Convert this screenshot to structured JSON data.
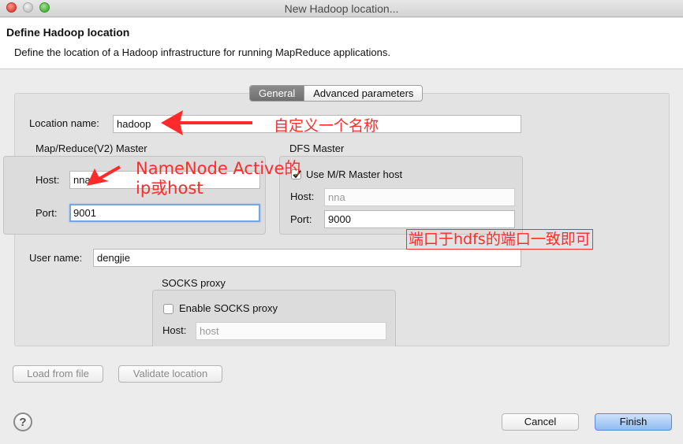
{
  "window": {
    "title": "New Hadoop location..."
  },
  "header": {
    "title": "Define Hadoop location",
    "description": "Define the location of a Hadoop infrastructure for running MapReduce applications."
  },
  "tabs": [
    {
      "label": "General",
      "selected": true
    },
    {
      "label": "Advanced parameters",
      "selected": false
    }
  ],
  "form": {
    "location_name": {
      "label": "Location name:",
      "value": "hadoop"
    },
    "mapreduce_master": {
      "title": "Map/Reduce(V2) Master",
      "host_label": "Host:",
      "host_value": "nna",
      "port_label": "Port:",
      "port_value": "9001"
    },
    "dfs_master": {
      "title": "DFS Master",
      "use_mr_host_label": "Use M/R Master host",
      "use_mr_host_checked": true,
      "host_label": "Host:",
      "host_placeholder": "nna",
      "port_label": "Port:",
      "port_value": "9000"
    },
    "user_name": {
      "label": "User name:",
      "value": "dengjie"
    },
    "socks_proxy": {
      "title": "SOCKS proxy",
      "enable_label": "Enable SOCKS proxy",
      "enable_checked": false,
      "host_label": "Host:",
      "host_placeholder": "host"
    }
  },
  "buttons": {
    "load_from_file": "Load from file",
    "validate_location": "Validate location",
    "cancel": "Cancel",
    "finish": "Finish",
    "help": "?"
  },
  "annotations": {
    "location_note": "自定义一个名称",
    "host_note_line1": "NameNode Active的",
    "host_note_line2": "ip或host",
    "port_note": "端口于hdfs的端口一致即可"
  },
  "colors": {
    "annotation": "#ff2b2b",
    "focus_ring": "#78a6e3",
    "finish_button": "#8fbbf0"
  }
}
